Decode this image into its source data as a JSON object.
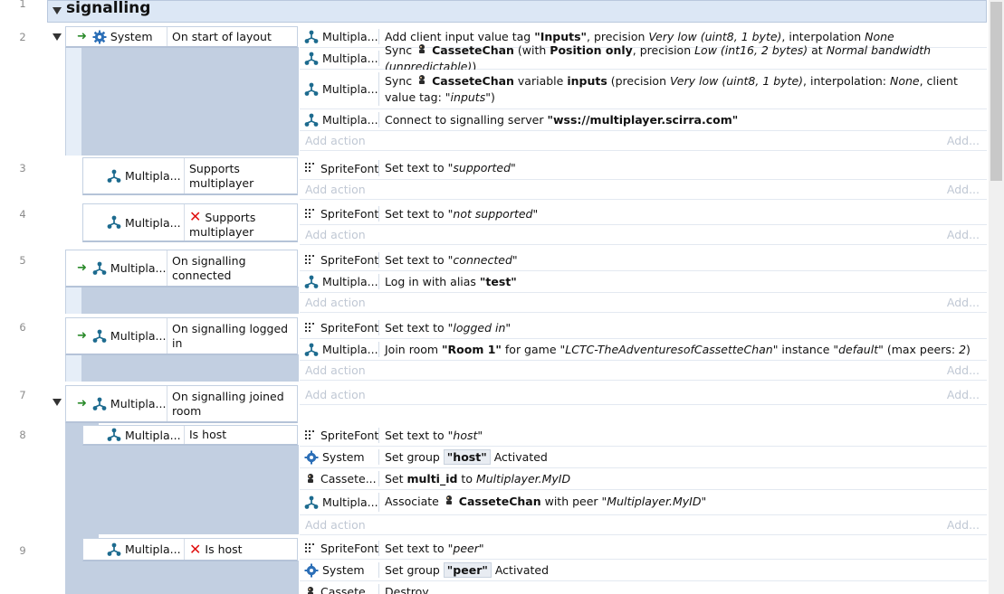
{
  "group": {
    "title": "signalling",
    "line": "1"
  },
  "add_action_label": "Add action",
  "add_more_label": "Add...",
  "events": [
    {
      "line": "2",
      "condition": {
        "object": "System",
        "text": "On start of layout"
      },
      "actions": [
        {
          "object": "Multipla...",
          "parts": [
            "Add client input value tag ",
            "\"Inputs\"",
            ", precision ",
            "Very low (uint8, 1 byte)",
            ", interpolation ",
            "None"
          ]
        },
        {
          "object": "Multipla...",
          "parts": [
            "Sync ",
            "CasseteChan",
            " (with ",
            "Position only",
            ", precision ",
            "Low (int16, 2 bytes)",
            " at ",
            "Normal bandwidth (unpredictable)",
            ")"
          ]
        },
        {
          "object": "Multipla...",
          "parts": [
            "Sync ",
            "CasseteChan",
            " variable ",
            "inputs",
            " (precision ",
            "Very low (uint8, 1 byte)",
            ", interpolation: ",
            "None",
            ", client value tag: ",
            "\"inputs\"",
            ")"
          ]
        },
        {
          "object": "Multipla...",
          "parts": [
            "Connect to signalling server ",
            "\"wss://multiplayer.scirra.com\""
          ]
        }
      ]
    },
    {
      "line": "3",
      "condition": {
        "object": "Multipla...",
        "text": "Supports multiplayer"
      },
      "actions": [
        {
          "object": "SpriteFont",
          "parts": [
            "Set text to ",
            "\"supported\""
          ]
        }
      ]
    },
    {
      "line": "4",
      "condition": {
        "object": "Multipla...",
        "text": "Supports multiplayer",
        "inverted_mark": "✕"
      },
      "actions": [
        {
          "object": "SpriteFont",
          "parts": [
            "Set text to ",
            "\"not supported\""
          ]
        }
      ]
    },
    {
      "line": "5",
      "condition": {
        "object": "Multipla...",
        "text": "On signalling connected"
      },
      "actions": [
        {
          "object": "SpriteFont",
          "parts": [
            "Set text to ",
            "\"connected\""
          ]
        },
        {
          "object": "Multipla...",
          "parts": [
            "Log in with alias ",
            "\"test\""
          ]
        }
      ]
    },
    {
      "line": "6",
      "condition": {
        "object": "Multipla...",
        "text": "On signalling logged in"
      },
      "actions": [
        {
          "object": "SpriteFont",
          "parts": [
            "Set text to ",
            "\"logged in\""
          ]
        },
        {
          "object": "Multipla...",
          "parts": [
            "Join room ",
            "\"Room 1\"",
            " for game ",
            "\"LCTC-TheAdventuresofCassetteChan\"",
            " instance ",
            "\"default\"",
            " (max peers: ",
            "2",
            ")"
          ]
        }
      ]
    },
    {
      "line": "7",
      "condition": {
        "object": "Multipla...",
        "text": "On signalling joined room"
      },
      "actions": []
    },
    {
      "line": "8",
      "condition": {
        "object": "Multipla...",
        "text": "Is host"
      },
      "actions": [
        {
          "object": "SpriteFont",
          "parts": [
            "Set text to ",
            "\"host\""
          ]
        },
        {
          "object": "System",
          "parts": [
            "Set group ",
            "\"host\"",
            " Activated"
          ]
        },
        {
          "object": "Cassete...",
          "parts": [
            "Set ",
            "multi_id",
            " to ",
            "Multiplayer.MyID"
          ]
        },
        {
          "object": "Multipla...",
          "parts": [
            "Associate ",
            "CasseteChan",
            " with peer ",
            "\"Multiplayer.MyID\""
          ]
        }
      ]
    },
    {
      "line": "9",
      "condition": {
        "object": "Multipla...",
        "text": "Is host",
        "inverted_mark": "✕"
      },
      "actions": [
        {
          "object": "SpriteFont",
          "parts": [
            "Set text to ",
            "\"peer\""
          ]
        },
        {
          "object": "System",
          "parts": [
            "Set group ",
            "\"peer\"",
            " Activated"
          ]
        },
        {
          "object": "Cassete...",
          "parts": [
            "Destroy"
          ]
        }
      ]
    }
  ]
}
